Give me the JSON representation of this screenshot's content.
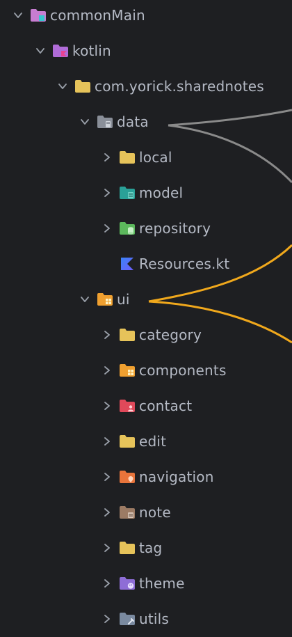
{
  "tree": {
    "nodes": [
      {
        "label": "commonMain",
        "depth": 0,
        "expanded": true,
        "icon": "source-root-folder-icon",
        "color": "#c77dd1"
      },
      {
        "label": "kotlin",
        "depth": 1,
        "expanded": true,
        "icon": "kotlin-folder-icon",
        "color": "#b06cd8"
      },
      {
        "label": "com.yorick.sharednotes",
        "depth": 2,
        "expanded": true,
        "icon": "package-folder-icon",
        "color": "#e6c35a"
      },
      {
        "label": "data",
        "depth": 3,
        "expanded": true,
        "icon": "data-folder-icon",
        "color": "#8a8f99"
      },
      {
        "label": "local",
        "depth": 4,
        "expanded": false,
        "icon": "folder-icon",
        "color": "#e6c35a"
      },
      {
        "label": "model",
        "depth": 4,
        "expanded": false,
        "icon": "model-folder-icon",
        "color": "#2aa198"
      },
      {
        "label": "repository",
        "depth": 4,
        "expanded": false,
        "icon": "repository-folder-icon",
        "color": "#5cb85c"
      },
      {
        "label": "Resources.kt",
        "depth": 4,
        "expanded": null,
        "icon": "kotlin-file-icon",
        "color": "#4a7cff"
      },
      {
        "label": "ui",
        "depth": 3,
        "expanded": true,
        "icon": "ui-folder-icon",
        "color": "#f0a030"
      },
      {
        "label": "category",
        "depth": 4,
        "expanded": false,
        "icon": "folder-icon",
        "color": "#e6c35a"
      },
      {
        "label": "components",
        "depth": 4,
        "expanded": false,
        "icon": "components-folder-icon",
        "color": "#f0a030"
      },
      {
        "label": "contact",
        "depth": 4,
        "expanded": false,
        "icon": "contact-folder-icon",
        "color": "#e0495a"
      },
      {
        "label": "edit",
        "depth": 4,
        "expanded": false,
        "icon": "folder-icon",
        "color": "#e6c35a"
      },
      {
        "label": "navigation",
        "depth": 4,
        "expanded": false,
        "icon": "navigation-folder-icon",
        "color": "#e8743b"
      },
      {
        "label": "note",
        "depth": 4,
        "expanded": false,
        "icon": "note-folder-icon",
        "color": "#9c7b64"
      },
      {
        "label": "tag",
        "depth": 4,
        "expanded": false,
        "icon": "folder-icon",
        "color": "#e6c35a"
      },
      {
        "label": "theme",
        "depth": 4,
        "expanded": false,
        "icon": "theme-folder-icon",
        "color": "#8e6dd6"
      },
      {
        "label": "utils",
        "depth": 4,
        "expanded": false,
        "icon": "utils-folder-icon",
        "color": "#7a8aa0"
      }
    ]
  },
  "annotations": {
    "gray_color": "#8a8a8a",
    "orange_color": "#f0a81c"
  }
}
